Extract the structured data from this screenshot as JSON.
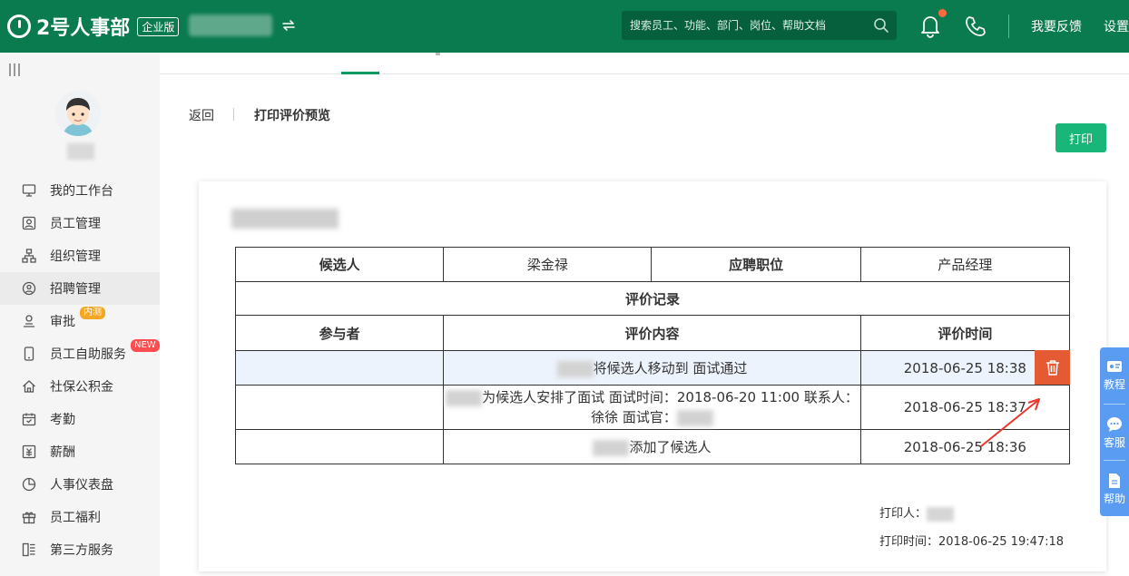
{
  "header": {
    "logo_text": "2号人事部",
    "edition": "企业版",
    "search_placeholder": "搜索员工、功能、部门、岗位、帮助文档",
    "feedback": "我要反馈",
    "settings": "设置"
  },
  "sidebar": {
    "items": [
      {
        "label": "我的工作台",
        "icon": "monitor-icon"
      },
      {
        "label": "员工管理",
        "icon": "person-card-icon"
      },
      {
        "label": "组织管理",
        "icon": "org-chart-icon"
      },
      {
        "label": "招聘管理",
        "icon": "recruit-icon",
        "active": true
      },
      {
        "label": "审批",
        "icon": "approval-icon",
        "badge": "内测"
      },
      {
        "label": "员工自助服务",
        "icon": "mobile-icon",
        "badge": "NEW"
      },
      {
        "label": "社保公积金",
        "icon": "house-icon"
      },
      {
        "label": "考勤",
        "icon": "calendar-icon"
      },
      {
        "label": "薪酬",
        "icon": "money-icon"
      },
      {
        "label": "人事仪表盘",
        "icon": "pie-chart-icon"
      },
      {
        "label": "员工福利",
        "icon": "gift-icon"
      },
      {
        "label": "第三方服务",
        "icon": "apps-icon"
      }
    ]
  },
  "breadcrumb": {
    "back": "返回",
    "title": "打印评价预览"
  },
  "print_button": "打印",
  "table": {
    "candidate_label": "候选人",
    "candidate_name": "梁金禄",
    "position_label": "应聘职位",
    "position_value": "产品经理",
    "section_title": "评价记录",
    "col_participant": "参与者",
    "col_content": "评价内容",
    "col_time": "评价时间",
    "rows": [
      {
        "content": "将候选人移动到 面试通过",
        "time": "2018-06-25 18:38"
      },
      {
        "content_line1": "为候选人安排了面试 面试时间：2018-06-20 11:00 联系人：",
        "content_line2": "徐徐 面试官：",
        "time": "2018-06-25 18:37"
      },
      {
        "content": "添加了候选人",
        "time": "2018-06-25 18:36"
      }
    ]
  },
  "footer": {
    "printer_label": "打印人：",
    "print_time": "打印时间：2018-06-25 19:47:18"
  },
  "float_bar": {
    "tutorial": "教程",
    "service": "客服",
    "help": "帮助"
  },
  "colors": {
    "header_bg": "#0a7a4f",
    "primary_button": "#18b779",
    "delete_button": "#e45a32",
    "float_bar": "#5b9cf3",
    "highlight_row": "#edf3fc"
  }
}
